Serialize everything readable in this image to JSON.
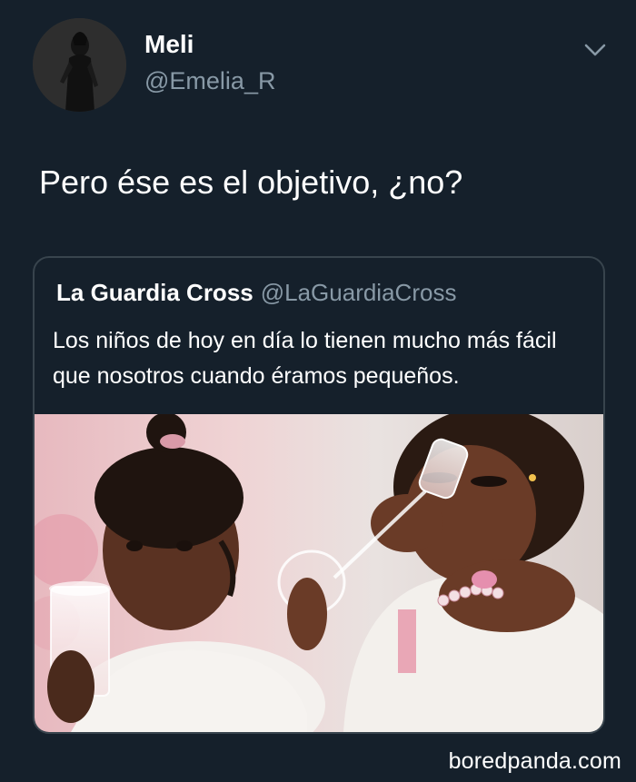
{
  "tweet": {
    "author": {
      "display_name": "Meli",
      "handle": "@Emelia_R"
    },
    "text": "Pero ése es el objetivo, ¿no?",
    "menu_icon": "chevron-down-icon"
  },
  "quoted_tweet": {
    "author": {
      "display_name": "La Guardia Cross",
      "handle": "@LaGuardiaCross"
    },
    "text": "Los niños de hoy en día lo tienen mucho más fácil que nosotros cuando éramos pequeños."
  },
  "watermark": "boredpanda.com",
  "colors": {
    "background": "#15202b",
    "border": "#38444d",
    "secondary_text": "#8899a6",
    "primary_text": "#ffffff"
  }
}
